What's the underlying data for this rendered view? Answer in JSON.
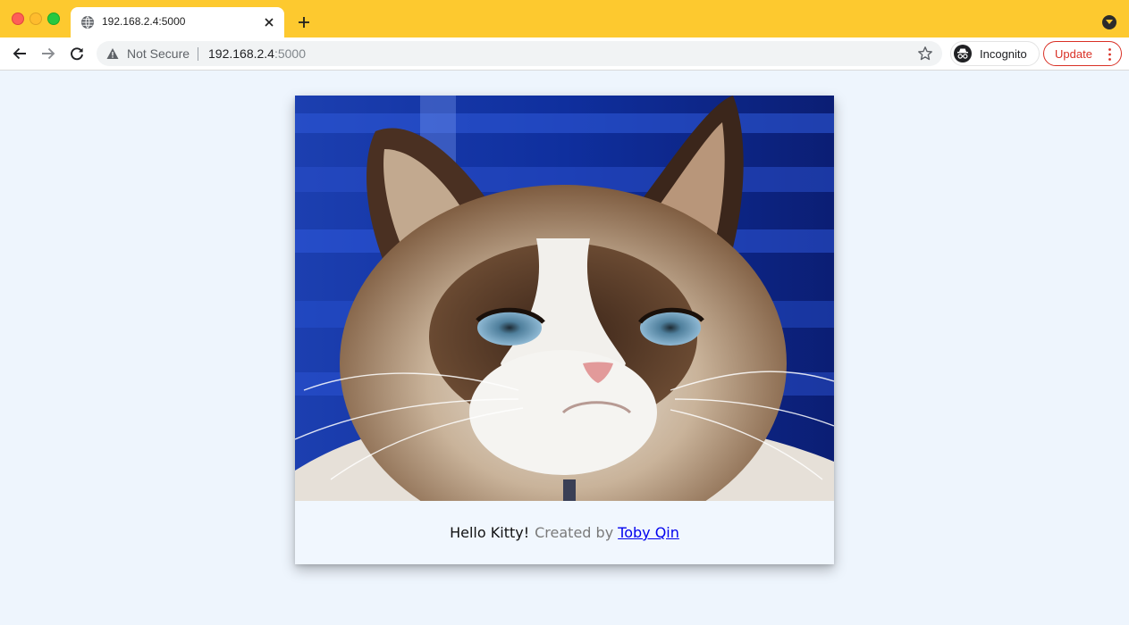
{
  "tab": {
    "title": "192.168.2.4:5000",
    "icon": "globe-icon"
  },
  "toolbar": {
    "security_label": "Not Secure",
    "url_host": "192.168.2.4",
    "url_port": ":5000",
    "incognito_label": "Incognito",
    "update_label": "Update"
  },
  "colors": {
    "tabstrip": "#fdc92f",
    "page_background": "#eef5fd",
    "update_accent": "#d93025",
    "link": "#0000ee"
  },
  "page": {
    "image_subject": "grumpy cat photo",
    "caption": {
      "greeting": "Hello Kitty!",
      "created_by": "Created by",
      "author": "Toby Qin"
    }
  }
}
